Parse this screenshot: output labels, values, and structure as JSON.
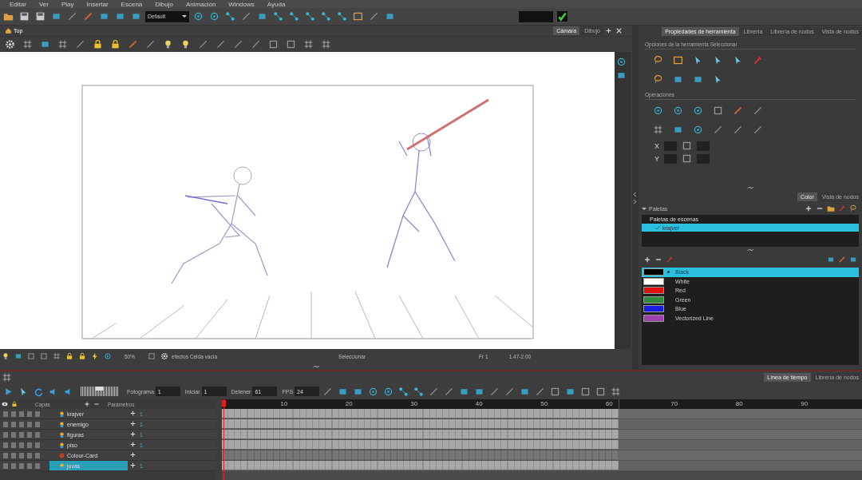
{
  "menu": [
    "Editar",
    "Ver",
    "Play",
    "Insertar",
    "Escena",
    "Dibujo",
    "Animación",
    "Windows",
    "Ayuda"
  ],
  "toolbar": {
    "preset": "Default"
  },
  "view": {
    "tabs": [
      {
        "label": "Top",
        "selected": true
      }
    ],
    "view_tabs": [
      {
        "label": "Cámara",
        "selected": true
      },
      {
        "label": "Dibujo",
        "selected": false
      }
    ]
  },
  "status_bar": {
    "zoom": "50%",
    "effects": "efectos Celda vacía",
    "tool": "Seleccionar",
    "frame": "Fr 1",
    "coords": "1.47-2.00"
  },
  "properties_panel": {
    "tabs": [
      {
        "label": "Propiedades de herramienta",
        "selected": true
      },
      {
        "label": "Librería",
        "selected": false
      },
      {
        "label": "Librería de nodos",
        "selected": false
      },
      {
        "label": "Vista de nodos",
        "selected": false
      }
    ],
    "options_title": "Opciones de la herramienta Seleccionar",
    "operations_title": "Operaciones",
    "fields": [
      {
        "label": "X"
      },
      {
        "label": "Y"
      }
    ]
  },
  "color_panel": {
    "tabs": [
      {
        "label": "Color",
        "selected": true
      },
      {
        "label": "Vista de nodos",
        "selected": false
      }
    ],
    "palettes": {
      "label": "Paletas",
      "expanded": true
    },
    "palette_list": {
      "header": "Paletas de escenas",
      "items": [
        {
          "name": "krajver",
          "selected": true
        }
      ]
    },
    "colors": [
      {
        "name": "Black",
        "color": "#000000",
        "selected": true
      },
      {
        "name": "White",
        "color": "#ffffff",
        "selected": false
      },
      {
        "name": "Red",
        "color": "#e01010",
        "selected": false
      },
      {
        "name": "Green",
        "color": "#2e8b3a",
        "selected": false
      },
      {
        "name": "Blue",
        "color": "#1a1ae0",
        "selected": false
      },
      {
        "name": "Vectorized Line",
        "color": "#a040b0",
        "selected": false
      }
    ]
  },
  "timeline": {
    "tabs": [
      {
        "label": "Línea de tiempo",
        "selected": true
      },
      {
        "label": "Librería de nodos",
        "selected": false
      }
    ],
    "jog": {
      "level": 0.5
    },
    "frame_label": "Fotograma",
    "frame": "1",
    "start_label": "Iniciar",
    "start": "1",
    "stop_label": "Detener",
    "stop": "61",
    "fps_label": "FPS",
    "fps": "24",
    "layers_header": "Capas",
    "params_header": "Parámetros",
    "ruler": [
      "10",
      "20",
      "30",
      "40",
      "50",
      "60",
      "70",
      "80",
      "90"
    ],
    "layers": [
      {
        "name": "krajver",
        "kind": "drawing",
        "param": "1",
        "selected": false
      },
      {
        "name": "enemigo",
        "kind": "drawing",
        "param": "1",
        "selected": false
      },
      {
        "name": "figuras",
        "kind": "drawing",
        "param": "1",
        "selected": false
      },
      {
        "name": "piso",
        "kind": "drawing",
        "param": "1",
        "selected": false
      },
      {
        "name": "Colour-Card",
        "kind": "colour-card",
        "selected": false
      },
      {
        "name": "juvas",
        "kind": "drawing",
        "param": "1",
        "selected": true
      }
    ]
  }
}
